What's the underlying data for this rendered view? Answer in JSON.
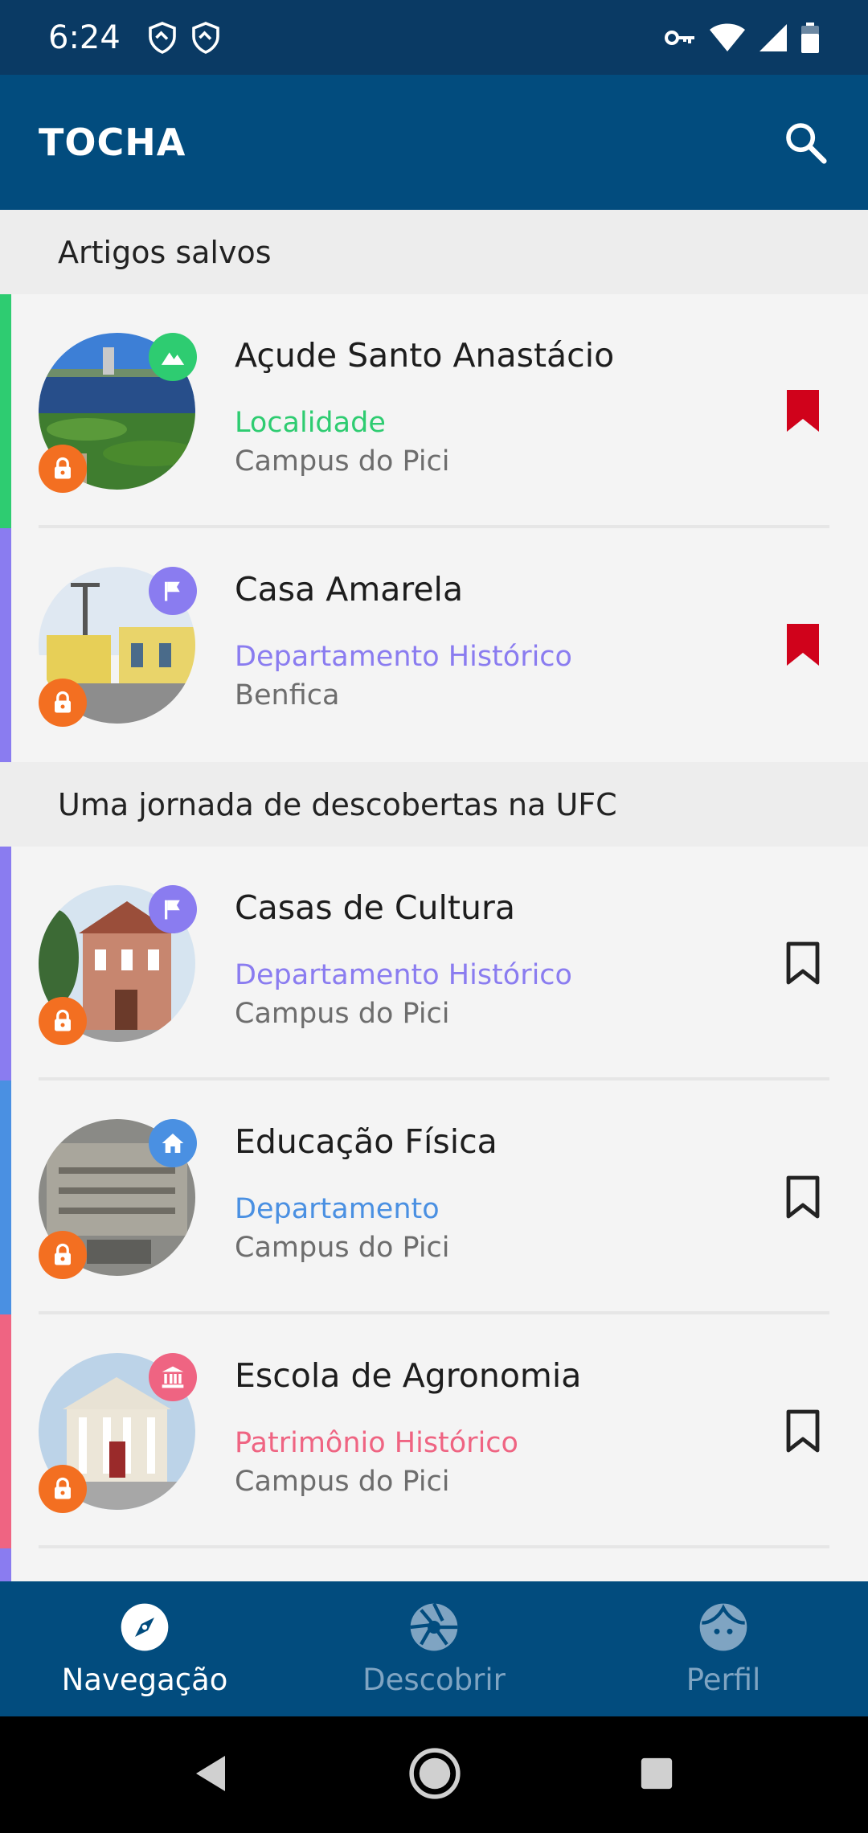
{
  "status_bar": {
    "time": "6:24"
  },
  "app_bar": {
    "title": "TOCHA"
  },
  "sections": [
    {
      "title": "Artigos salvos"
    },
    {
      "title": "Uma jornada de descobertas na UFC"
    }
  ],
  "items": [
    {
      "title": "Açude Santo Anastácio",
      "category": "Localidade",
      "location": "Campus do Pici",
      "category_color": "#2ecc71",
      "bookmarked": true,
      "type_icon": "landscape-icon"
    },
    {
      "title": "Casa Amarela",
      "category": "Departamento Histórico",
      "location": "Benfica",
      "category_color": "#8a7cf0",
      "bookmarked": true,
      "type_icon": "flag-icon"
    },
    {
      "title": "Casas de Cultura",
      "category": "Departamento Histórico",
      "location": "Campus do Pici",
      "category_color": "#8a7cf0",
      "bookmarked": false,
      "type_icon": "flag-icon"
    },
    {
      "title": "Educação Física",
      "category": "Departamento",
      "location": "Campus do Pici",
      "category_color": "#4a90e2",
      "bookmarked": false,
      "type_icon": "home-icon"
    },
    {
      "title": "Escola de Agronomia",
      "category": "Patrimônio Histórico",
      "location": "Campus do Pici",
      "category_color": "#ef6482",
      "bookmarked": false,
      "type_icon": "museum-icon"
    }
  ],
  "bottom_nav": {
    "items": [
      {
        "label": "Navegação",
        "icon": "compass-icon",
        "active": true
      },
      {
        "label": "Descobrir",
        "icon": "aperture-icon",
        "active": false
      },
      {
        "label": "Perfil",
        "icon": "face-icon",
        "active": false
      }
    ]
  },
  "colors": {
    "status_bar": "#0a3a64",
    "app_bar": "#024c7e",
    "lock_badge": "#f36f21",
    "bookmark_active": "#d0021b"
  }
}
